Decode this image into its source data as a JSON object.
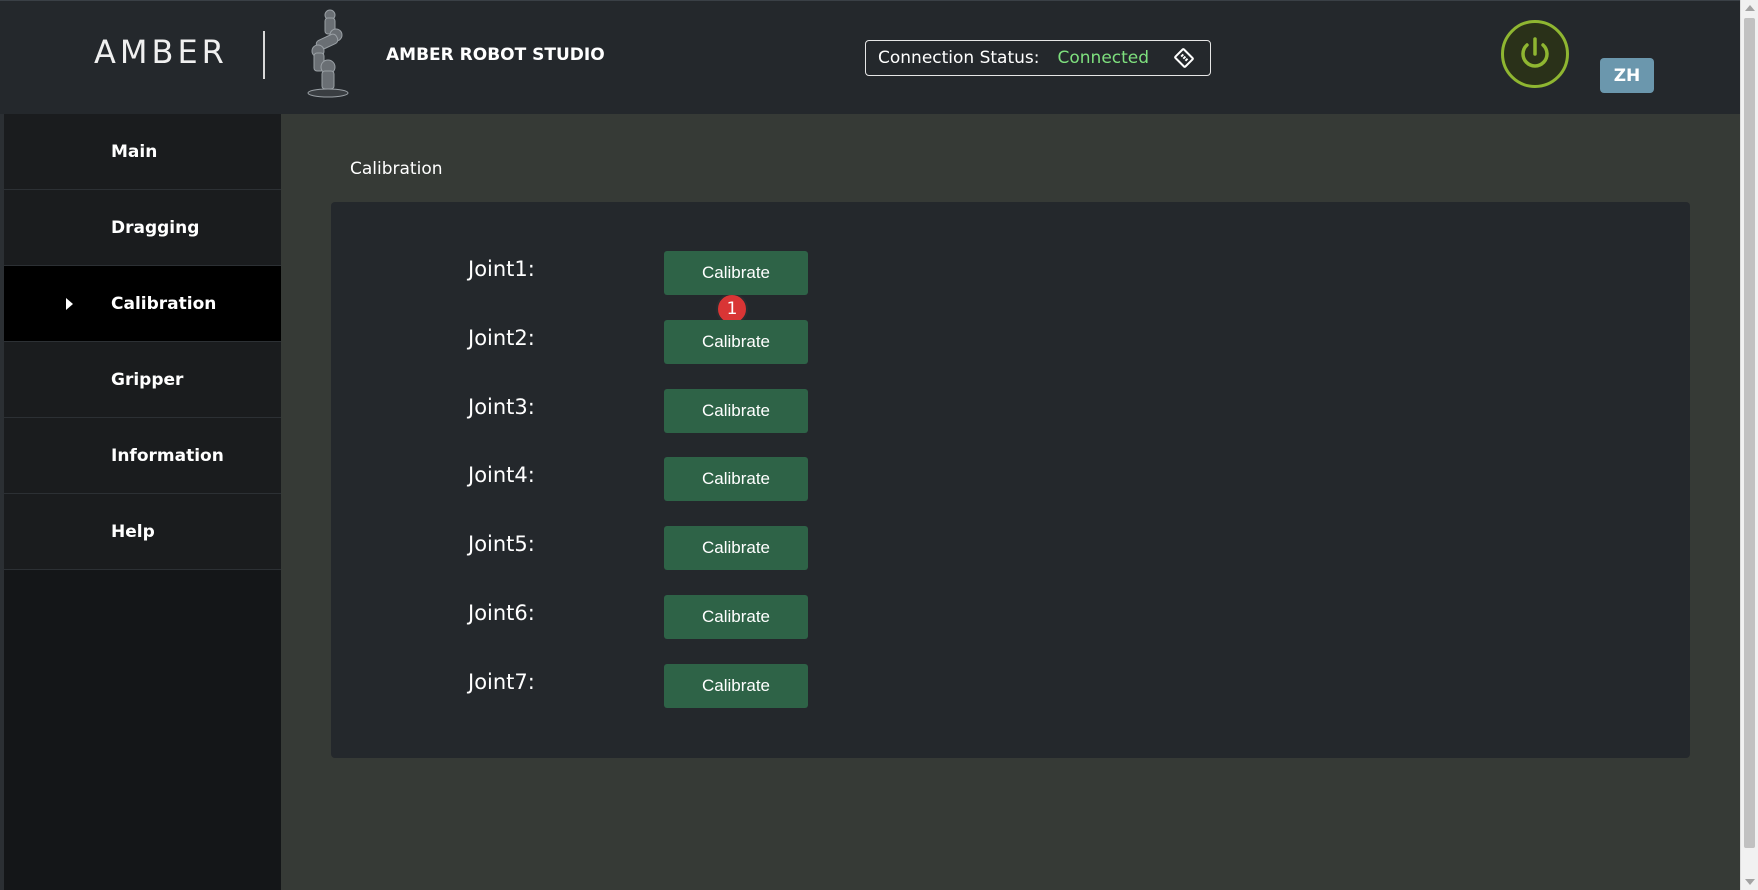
{
  "header": {
    "logo": "AMBER",
    "app_title": "AMBER ROBOT STUDIO",
    "connection": {
      "label": "Connection Status:",
      "value": "Connected",
      "value_color": "#7ee07e",
      "icon": "ethernet-port-icon"
    },
    "power_icon": "power-icon",
    "power_color": "#8fb631",
    "language_button": "ZH"
  },
  "sidebar": {
    "items": [
      {
        "label": "Main",
        "active": false
      },
      {
        "label": "Dragging",
        "active": false
      },
      {
        "label": "Calibration",
        "active": true
      },
      {
        "label": "Gripper",
        "active": false
      },
      {
        "label": "Information",
        "active": false
      },
      {
        "label": "Help",
        "active": false
      }
    ]
  },
  "main": {
    "section_title": "Calibration",
    "badge": "1",
    "joints": [
      {
        "label": "Joint1:",
        "button": "Calibrate"
      },
      {
        "label": "Joint2:",
        "button": "Calibrate"
      },
      {
        "label": "Joint3:",
        "button": "Calibrate"
      },
      {
        "label": "Joint4:",
        "button": "Calibrate"
      },
      {
        "label": "Joint5:",
        "button": "Calibrate"
      },
      {
        "label": "Joint6:",
        "button": "Calibrate"
      },
      {
        "label": "Joint7:",
        "button": "Calibrate"
      }
    ]
  },
  "colors": {
    "accent_button": "#2e6347",
    "badge": "#d93535",
    "active_nav": "#000000"
  }
}
